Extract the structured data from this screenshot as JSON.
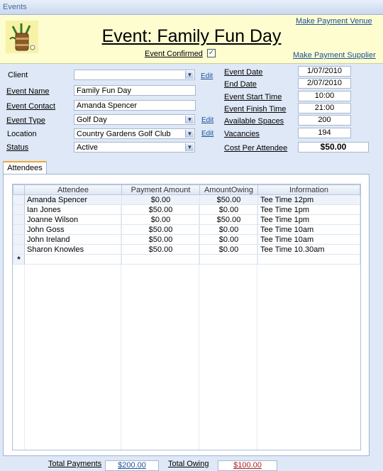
{
  "window": {
    "title": "Events"
  },
  "header": {
    "title": "Event: Family Fun Day",
    "confirmed_label": "Event Confirmed",
    "confirmed": true,
    "make_payment_venue": "Make Payment Venue",
    "make_payment_supplier": "Make Payment Supplier"
  },
  "form": {
    "client_label": "Client",
    "client_value": "",
    "event_name_label": "Event Name",
    "event_name_value": "Family Fun Day",
    "event_contact_label": "Event Contact",
    "event_contact_value": "Amanda Spencer",
    "event_type_label": "Event Type",
    "event_type_value": "Golf Day",
    "location_label": "Location",
    "location_value": "Country Gardens Golf Club",
    "status_label": "Status",
    "status_value": "Active",
    "edit_label": "Edit"
  },
  "details": {
    "event_date_label": "Event Date",
    "event_date_value": "1/07/2010",
    "end_date_label": "End Date",
    "end_date_value": "2/07/2010",
    "start_time_label": "Event Start Time",
    "start_time_value": "10:00",
    "finish_time_label": "Event Finish Time",
    "finish_time_value": "21:00",
    "available_spaces_label": "Available Spaces",
    "available_spaces_value": "200",
    "vacancies_label": "Vacancies",
    "vacancies_value": "194",
    "cost_label": "Cost Per Attendee",
    "cost_value": "$50.00"
  },
  "tabs": {
    "attendees": "Attendees"
  },
  "attendees": {
    "columns": [
      "Attendee",
      "Payment Amount",
      "AmountOwing",
      "Information"
    ],
    "rows": [
      [
        "Amanda Spencer",
        "$0.00",
        "$50.00",
        "Tee Time 12pm"
      ],
      [
        "Ian Jones",
        "$50.00",
        "$0.00",
        "Tee Time 1pm"
      ],
      [
        "Joanne Wilson",
        "$0.00",
        "$50.00",
        "Tee Time 1pm"
      ],
      [
        "John Goss",
        "$50.00",
        "$0.00",
        "Tee Time 10am"
      ],
      [
        "John Ireland",
        "$50.00",
        "$0.00",
        "Tee Time 10am"
      ],
      [
        "Sharon Knowles",
        "$50.00",
        "$0.00",
        "Tee Time 10.30am"
      ]
    ],
    "new_row_marker": "*"
  },
  "totals": {
    "total_payments_label": "Total Payments",
    "total_payments_value": "$200.00",
    "total_owing_label": "Total Owing",
    "total_owing_value": "$100.00"
  },
  "colors": {
    "header_bg": "#fdfdd0",
    "link": "#1a4f9c",
    "owing_text": "#b02020",
    "tab_accent": "#f0a830"
  }
}
